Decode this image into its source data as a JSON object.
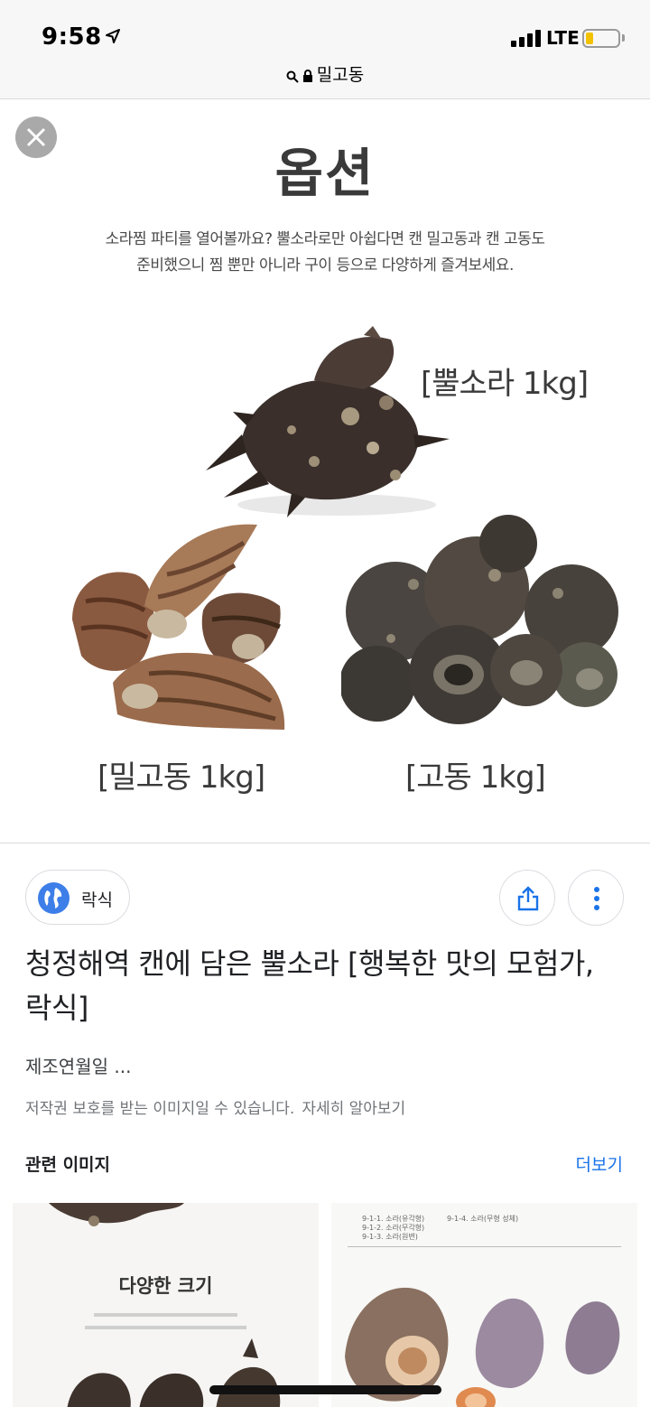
{
  "status_bar": {
    "time": "9:58",
    "network": "LTE",
    "location_icon": "location-arrow-icon",
    "battery_level": 0.2
  },
  "url_bar": {
    "query": "밀고동",
    "search_icon": "search-icon",
    "lock_icon": "lock-icon"
  },
  "image": {
    "heading": "옵션",
    "description_line1": "소라찜 파티를 열어볼까요? 뿔소라로만 아쉽다면 캔 밀고동과 캔 고동도",
    "description_line2": "준비했으니 찜 뿐만 아니라 구이 등으로 다양하게 즐겨보세요.",
    "label_bbulsora": "[뿔소라 1kg]",
    "label_milgodong": "[밀고동 1kg]",
    "label_godong": "[고동 1kg]"
  },
  "result": {
    "source_name": "락식",
    "title": "청정해역 캔에 담은 뿔소라 [행복한 맛의 모험가, 락식]",
    "snippet": "제조연월일 ...",
    "copyright_notice": "저작권 보호를 받는 이미지일 수 있습니다.",
    "learn_more": "자세히 알아보기"
  },
  "related": {
    "heading": "관련 이미지",
    "more_label": "더보기",
    "thumb1_title": "다양한 크기",
    "thumb2_captions": [
      "9-1-1. 소라(유각형)",
      "9-1-2. 소라(무각형)",
      "9-1-3. 소라(원변)",
      "9-1-4. 소라(무형 성체)"
    ]
  },
  "colors": {
    "accent": "#1a73e8",
    "globe": "#3d7ee8",
    "battery": "#f2c200"
  }
}
